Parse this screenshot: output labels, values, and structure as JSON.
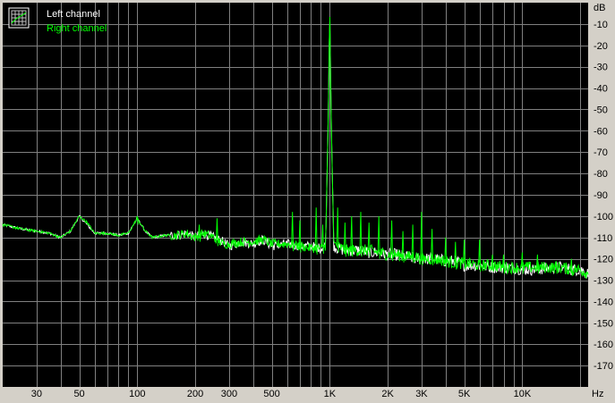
{
  "chart_data": {
    "type": "line",
    "x_scale": "log",
    "y_unit_label": "dB",
    "x_unit_label": "Hz",
    "xlim": [
      20,
      22000
    ],
    "ylim": [
      -180,
      0
    ],
    "x_tick_values": [
      30,
      50,
      100,
      200,
      300,
      500,
      1000,
      2000,
      3000,
      5000,
      10000
    ],
    "x_tick_labels": [
      "30",
      "50",
      "100",
      "200",
      "300",
      "500",
      "1K",
      "2K",
      "3K",
      "5K",
      "10K"
    ],
    "y_tick_values": [
      -10,
      -20,
      -30,
      -40,
      -50,
      -60,
      -70,
      -80,
      -90,
      -100,
      -110,
      -120,
      -130,
      -140,
      -150,
      -160,
      -170
    ],
    "y_tick_labels": [
      "-10",
      "-20",
      "-30",
      "-40",
      "-50",
      "-60",
      "-70",
      "-80",
      "-90",
      "-100",
      "-110",
      "-120",
      "-130",
      "-140",
      "-150",
      "-160",
      "-170"
    ],
    "grid": true,
    "legend_position": "top-left",
    "background_color": "#000000",
    "grid_color": "#808080",
    "series": [
      {
        "name": "Left channel",
        "color": "#ffffff",
        "x": [
          20,
          25,
          30,
          35,
          40,
          45,
          50,
          55,
          60,
          70,
          80,
          90,
          100,
          110,
          120,
          140,
          160,
          180,
          200,
          220,
          250,
          280,
          300,
          350,
          400,
          450,
          500,
          600,
          700,
          800,
          900,
          950,
          980,
          1000,
          1020,
          1050,
          1100,
          1200,
          1400,
          1600,
          1800,
          2000,
          2200,
          2500,
          2800,
          3000,
          3500,
          4000,
          4500,
          5000,
          6000,
          7000,
          8000,
          9000,
          10000,
          12000,
          14000,
          16000,
          18000,
          20000,
          22000
        ],
        "y": [
          -104,
          -106,
          -107,
          -108,
          -110,
          -107,
          -100,
          -104,
          -108,
          -108,
          -109,
          -108,
          -101,
          -107,
          -110,
          -109,
          -109,
          -108,
          -110,
          -108,
          -110,
          -112,
          -114,
          -112,
          -113,
          -111,
          -114,
          -113,
          -114,
          -114,
          -115,
          -114,
          -60,
          -3,
          -60,
          -114,
          -115,
          -116,
          -116,
          -117,
          -117,
          -118,
          -118,
          -119,
          -120,
          -120,
          -120,
          -121,
          -121,
          -123,
          -123,
          -124,
          -124,
          -124,
          -125,
          -125,
          -124,
          -124,
          -125,
          -125,
          -127
        ]
      },
      {
        "name": "Right channel",
        "color": "#00ff00",
        "x": [
          20,
          25,
          30,
          35,
          40,
          45,
          50,
          55,
          60,
          70,
          80,
          90,
          100,
          110,
          120,
          140,
          160,
          180,
          200,
          220,
          250,
          280,
          300,
          350,
          400,
          450,
          500,
          600,
          700,
          800,
          900,
          950,
          980,
          1000,
          1020,
          1050,
          1100,
          1200,
          1400,
          1600,
          1800,
          2000,
          2200,
          2500,
          2800,
          3000,
          3500,
          4000,
          4500,
          5000,
          6000,
          7000,
          8000,
          9000,
          10000,
          12000,
          14000,
          16000,
          18000,
          20000,
          22000
        ],
        "y": [
          -104,
          -106,
          -107,
          -108,
          -110,
          -107,
          -100,
          -103,
          -108,
          -108,
          -109,
          -108,
          -101,
          -107,
          -110,
          -109,
          -109,
          -108,
          -110,
          -108,
          -110,
          -113,
          -113,
          -112,
          -112,
          -111,
          -113,
          -113,
          -114,
          -115,
          -115,
          -114,
          -60,
          -1,
          -60,
          -113,
          -114,
          -116,
          -116,
          -116,
          -117,
          -118,
          -118,
          -119,
          -119,
          -120,
          -120,
          -121,
          -122,
          -122,
          -123,
          -123,
          -124,
          -124,
          -124,
          -124,
          -124,
          -124,
          -125,
          -125,
          -127
        ]
      }
    ],
    "spurs": [
      {
        "f": 100,
        "level": -100
      },
      {
        "f": 210,
        "level": -104
      },
      {
        "f": 260,
        "level": -101
      },
      {
        "f": 640,
        "level": -98
      },
      {
        "f": 700,
        "level": -102
      },
      {
        "f": 850,
        "level": -96
      },
      {
        "f": 920,
        "level": -104
      },
      {
        "f": 1100,
        "level": -96
      },
      {
        "f": 1200,
        "level": -103
      },
      {
        "f": 1300,
        "level": -100
      },
      {
        "f": 1450,
        "level": -98
      },
      {
        "f": 1600,
        "level": -103
      },
      {
        "f": 1800,
        "level": -100
      },
      {
        "f": 2100,
        "level": -102
      },
      {
        "f": 2400,
        "level": -107
      },
      {
        "f": 2700,
        "level": -104
      },
      {
        "f": 3000,
        "level": -98
      },
      {
        "f": 3400,
        "level": -106
      },
      {
        "f": 4000,
        "level": -110
      },
      {
        "f": 4500,
        "level": -112
      },
      {
        "f": 5000,
        "level": -111
      },
      {
        "f": 6000,
        "level": -111
      },
      {
        "f": 7000,
        "level": -118
      },
      {
        "f": 8000,
        "level": -118
      },
      {
        "f": 10000,
        "level": -117
      },
      {
        "f": 12000,
        "level": -118
      },
      {
        "f": 15000,
        "level": -121
      },
      {
        "f": 18000,
        "level": -120
      }
    ]
  }
}
